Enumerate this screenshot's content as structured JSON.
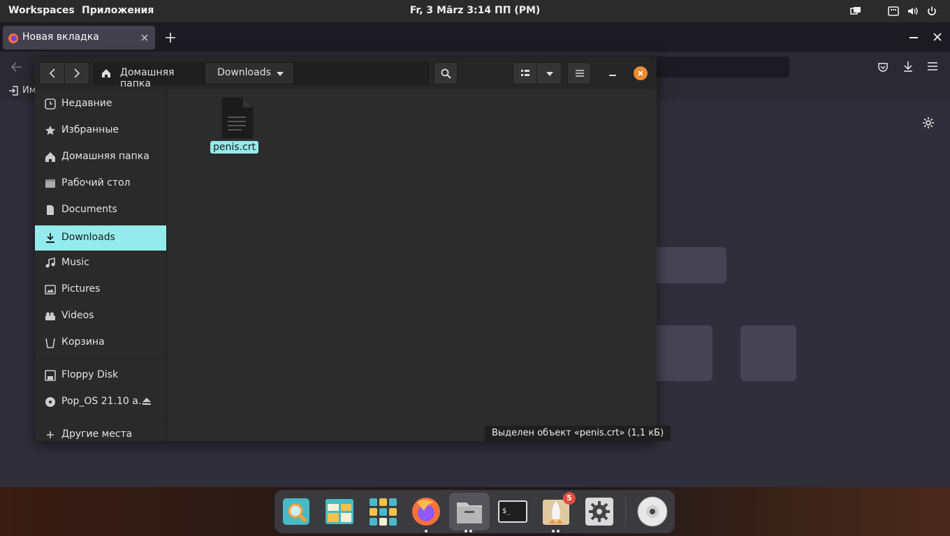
{
  "top_panel": {
    "workspaces": "Workspaces",
    "applications": "Приложения",
    "clock": "Fr, 3 März   3:14 ПП (PM)"
  },
  "firefox": {
    "tab_title": "Новая вкладка",
    "bookmark_label": "Им"
  },
  "file_manager": {
    "path": [
      "Домашняя папка",
      "Downloads"
    ],
    "sidebar": [
      {
        "label": "Недавние",
        "icon": "clock-icon"
      },
      {
        "label": "Избранные",
        "icon": "star-icon"
      },
      {
        "label": "Домашняя папка",
        "icon": "home-icon"
      },
      {
        "label": "Рабочий стол",
        "icon": "desktop-icon"
      },
      {
        "label": "Documents",
        "icon": "document-icon"
      },
      {
        "label": "Downloads",
        "icon": "download-icon",
        "selected": true
      },
      {
        "label": "Music",
        "icon": "music-icon"
      },
      {
        "label": "Pictures",
        "icon": "picture-icon"
      },
      {
        "label": "Videos",
        "icon": "video-icon"
      },
      {
        "label": "Корзина",
        "icon": "trash-icon"
      },
      {
        "label": "Floppy Disk",
        "icon": "floppy-icon"
      },
      {
        "label": "Pop_OS 21.10 a...",
        "icon": "disc-icon"
      },
      {
        "label": "Другие места",
        "icon": "plus-icon"
      }
    ],
    "file": {
      "name": "penis.crt"
    },
    "status": "Выделен объект «penis.crt» (1,1 кБ)"
  },
  "dock": {
    "badge_count": "5",
    "apps": [
      "search-app",
      "files-app",
      "app-grid",
      "firefox",
      "file-manager",
      "terminal",
      "pop-shop",
      "settings",
      "optical-disc"
    ]
  },
  "colors": {
    "accent": "#94ebeb",
    "close_button": "#f08a2f",
    "badge": "#e64a3c"
  }
}
